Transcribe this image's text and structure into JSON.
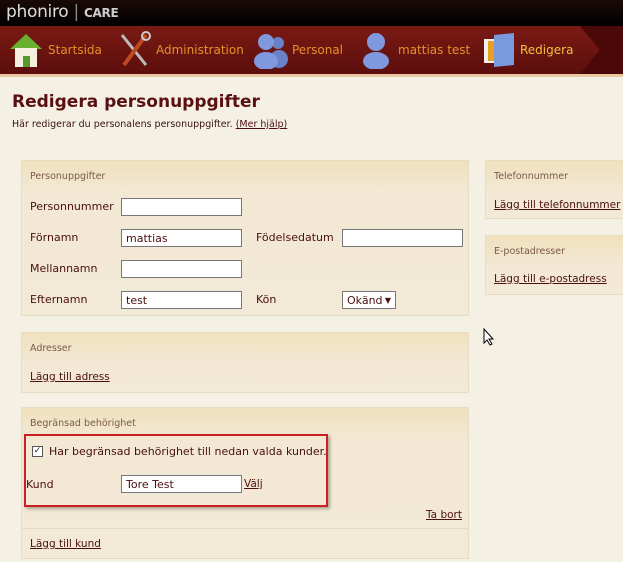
{
  "app": {
    "logo_main": "phoniro",
    "logo_sub": "CARE"
  },
  "nav": {
    "items": [
      {
        "label": "Startsida",
        "icon": "house-icon"
      },
      {
        "label": "Administration",
        "icon": "tools-icon"
      },
      {
        "label": "Personal",
        "icon": "users-icon"
      },
      {
        "label": "mattias test",
        "icon": "user-icon"
      },
      {
        "label": "Redigera",
        "icon": "folder-icon",
        "active": true
      }
    ]
  },
  "page": {
    "title": "Redigera personuppgifter",
    "subtitle": "Här redigerar du personalens personuppgifter.",
    "help_link": "(Mer hjälp)"
  },
  "person": {
    "header": "Personuppgifter",
    "personnummer_label": "Personnummer",
    "personnummer_value": "",
    "fornamn_label": "Förnamn",
    "fornamn_value": "mattias",
    "fodelsedatum_label": "Födelsedatum",
    "fodelsedatum_value": "",
    "mellannamn_label": "Mellannamn",
    "mellannamn_value": "",
    "efternamn_label": "Efternamn",
    "efternamn_value": "test",
    "kon_label": "Kön",
    "kon_value": "Okänd"
  },
  "adresser": {
    "header": "Adresser",
    "add_link": "Lägg till adress"
  },
  "telefon": {
    "header": "Telefonnummer",
    "add_link": "Lägg till telefonnummer"
  },
  "epost": {
    "header": "E-postadresser",
    "add_link": "Lägg till e-postadress"
  },
  "behorighet": {
    "header": "Begränsad behörighet",
    "checkbox_label": "Har begränsad behörighet till nedan valda kunder.",
    "checked": true,
    "kund_label": "Kund",
    "kund_value": "Tore Test",
    "valj_link": "Välj",
    "remove_link": "Ta bort",
    "add_link": "Lägg till kund",
    "highlight_color": "#cc1f1f"
  },
  "colors": {
    "nav_bg": "#6a1410",
    "nav_text": "#e6902a",
    "nav_active": "#f5c040",
    "page_bg": "#f4f1e4",
    "title": "#5a1010"
  }
}
